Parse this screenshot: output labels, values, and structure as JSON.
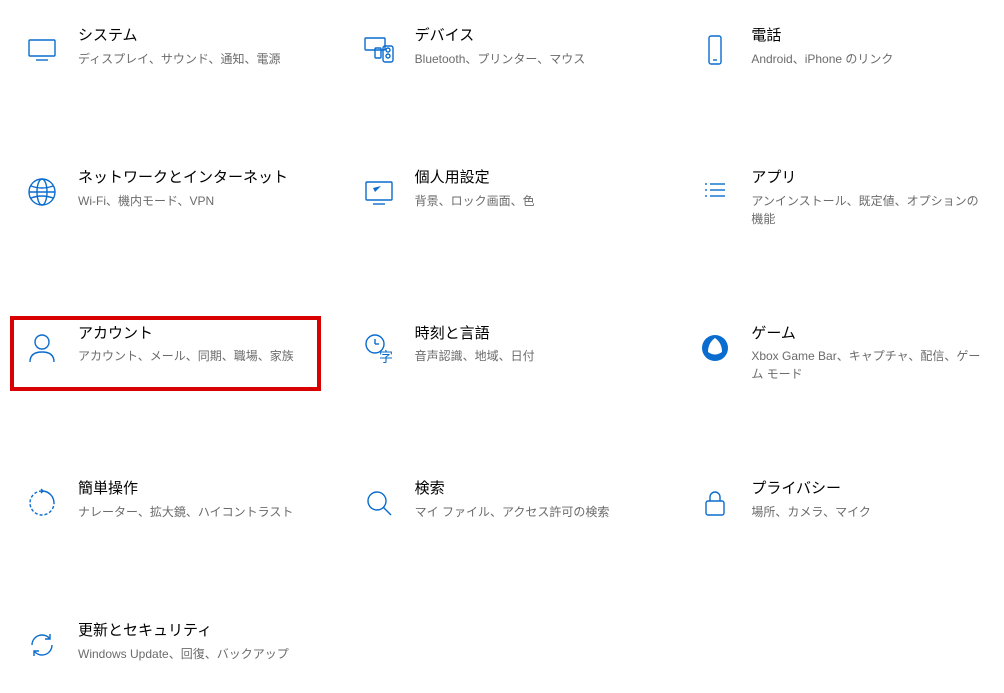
{
  "tiles": [
    {
      "id": "system",
      "title": "システム",
      "desc": "ディスプレイ、サウンド、通知、電源"
    },
    {
      "id": "devices",
      "title": "デバイス",
      "desc": "Bluetooth、プリンター、マウス"
    },
    {
      "id": "phone",
      "title": "電話",
      "desc": "Android、iPhone のリンク"
    },
    {
      "id": "network",
      "title": "ネットワークとインターネット",
      "desc": "Wi-Fi、機内モード、VPN"
    },
    {
      "id": "personal",
      "title": "個人用設定",
      "desc": "背景、ロック画面、色"
    },
    {
      "id": "apps",
      "title": "アプリ",
      "desc": "アンインストール、既定値、オプションの機能"
    },
    {
      "id": "accounts",
      "title": "アカウント",
      "desc": "アカウント、メール、同期、職場、家族",
      "highlight": true
    },
    {
      "id": "time",
      "title": "時刻と言語",
      "desc": "音声認識、地域、日付"
    },
    {
      "id": "gaming",
      "title": "ゲーム",
      "desc": "Xbox Game Bar、キャプチャ、配信、ゲーム モード"
    },
    {
      "id": "ease",
      "title": "簡単操作",
      "desc": "ナレーター、拡大鏡、ハイコントラスト"
    },
    {
      "id": "search",
      "title": "検索",
      "desc": "マイ ファイル、アクセス許可の検索"
    },
    {
      "id": "privacy",
      "title": "プライバシー",
      "desc": "場所、カメラ、マイク"
    },
    {
      "id": "update",
      "title": "更新とセキュリティ",
      "desc": "Windows Update、回復、バックアップ"
    }
  ]
}
